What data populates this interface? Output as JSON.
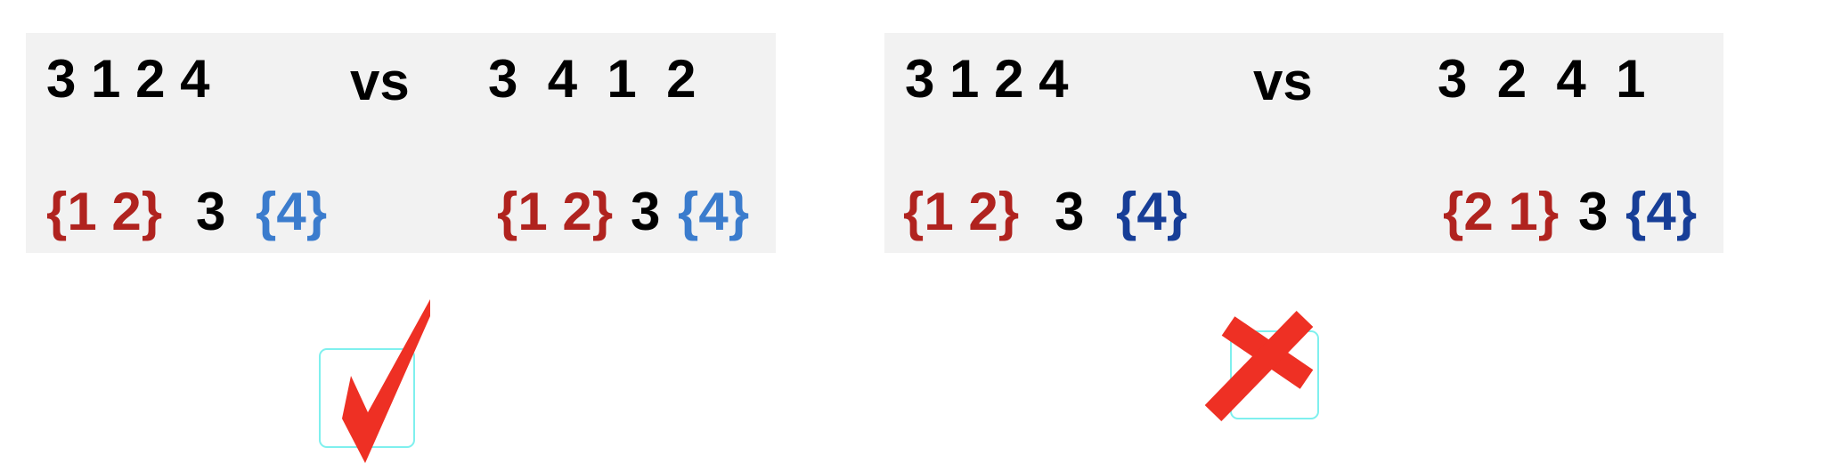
{
  "colors": {
    "panel": "#f2f2f2",
    "red_group": "#b0231f",
    "blue_group_left": "#3b7ccd",
    "blue_group_right": "#173e97",
    "black": "#000000",
    "mark_red": "#ee3024",
    "box_cyan": "#7ff0ee"
  },
  "left_panel": {
    "seq_a": "3 1 2 4",
    "vs": "vs",
    "seq_b": "3  4  1  2",
    "groups_a": {
      "red": "{1 2}",
      "middle": "3",
      "blue": "{4}"
    },
    "groups_b": {
      "red": "{1 2}",
      "middle": "3",
      "blue": "{4}"
    },
    "verdict_icon": "check-mark-icon"
  },
  "right_panel": {
    "seq_a": "3 1 2 4",
    "vs": "vs",
    "seq_b": "3  2  4  1",
    "groups_a": {
      "red": "{1 2}",
      "middle": "3",
      "blue": "{4}"
    },
    "groups_b": {
      "red": "{2 1}",
      "middle": "3",
      "blue": "{4}"
    },
    "verdict_icon": "cross-mark-icon"
  }
}
